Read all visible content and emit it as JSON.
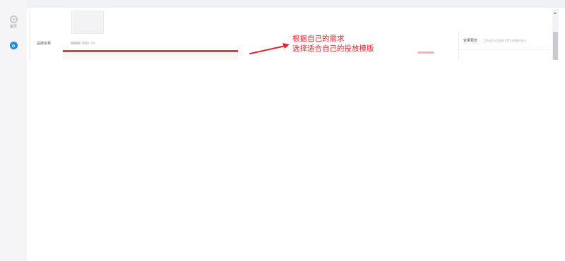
{
  "nav": {
    "home_label": "首页"
  },
  "form": {
    "brand_name_label": "品牌名称"
  },
  "annotation": {
    "line1": "根据自己的需求",
    "line2": "选择适合自己的投放模版",
    "color": "#e0262c"
  },
  "preview": {
    "title": "效果预览",
    "hint": "实际展示会根据位置不同略有变化"
  },
  "colors": {
    "accent": "#1e88e5",
    "highlight": "#e23b3b"
  }
}
